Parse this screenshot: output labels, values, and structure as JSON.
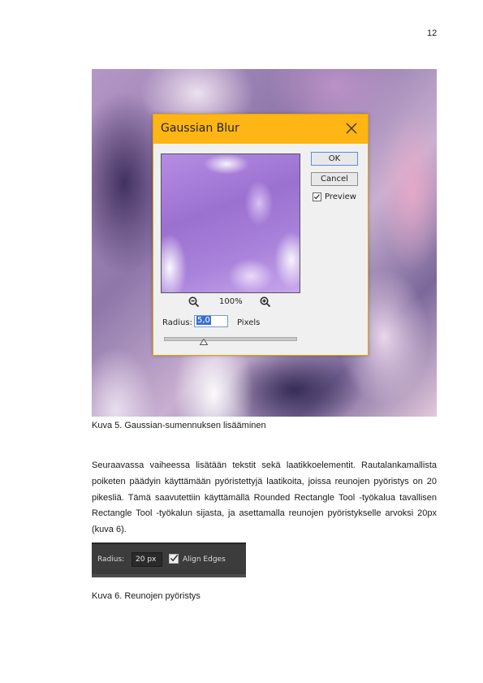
{
  "page_number": "12",
  "figure5": {
    "dialog_title": "Gaussian Blur",
    "ok_label": "OK",
    "cancel_label": "Cancel",
    "preview_label": "Preview",
    "preview_checked": true,
    "zoom_value": "100%",
    "radius_label": "Radius:",
    "radius_value": "5,0",
    "radius_unit": "Pixels",
    "slider_position": 0.3,
    "titlebar_color": "#fdb51c",
    "icons": [
      "close-icon",
      "zoom-out-icon",
      "zoom-in-icon",
      "checkmark-icon",
      "slider-thumb-icon"
    ],
    "caption": "Kuva 5. Gaussian-sumennuksen lisääminen"
  },
  "paragraph": "Seuraavassa vaiheessa lisätään tekstit sekä laatikkoelementit. Rautalankamallista poiketen päädyin käyttämään pyöristettyjä laatikoita, joissa reunojen pyöristys on 20 pikesliä. Tämä saavutettiin käyttämällä Rounded Rectangle Tool -työkalua tavallisen Rectangle Tool -työkalun sijasta, ja asettamalla reunojen pyöristykselle arvoksi 20px (kuva 6).",
  "figure6": {
    "radius_label": "Radius:",
    "radius_value": "20 px",
    "align_edges_label": "Align Edges",
    "align_edges_checked": true,
    "caption": "Kuva 6. Reunojen pyöristys"
  }
}
